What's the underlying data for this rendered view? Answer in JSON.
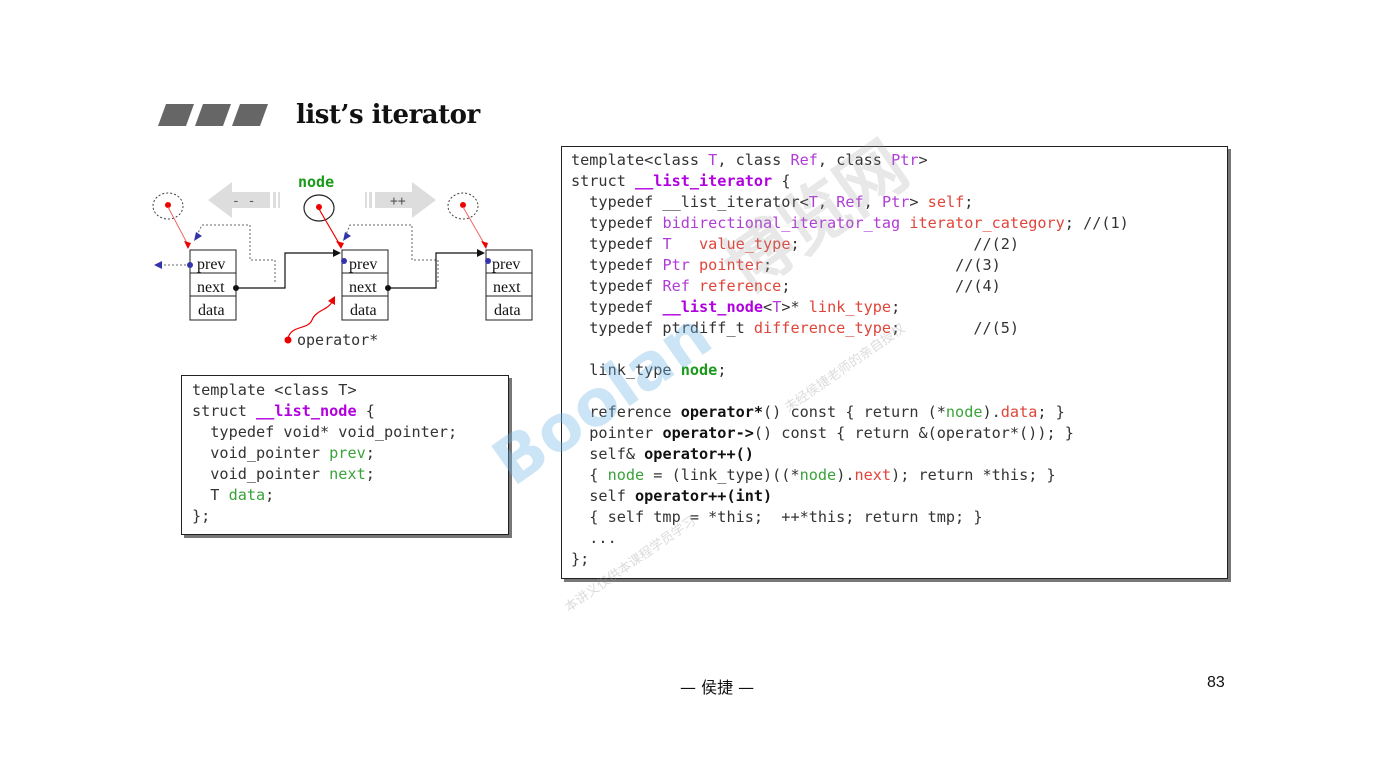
{
  "slide": {
    "title": "list’s iterator",
    "author": "— 侯捷 —",
    "page_number": "83"
  },
  "diagram": {
    "node_label": "node",
    "decrement_label": "- -",
    "increment_label": "++",
    "operator_label": "operator*",
    "cells": {
      "prev": "prev",
      "next": "next",
      "data": "data"
    }
  },
  "node_code": {
    "l1": "template <class T>",
    "l2a": "struct ",
    "l2b": "__list_node",
    "l2c": " {",
    "l3": "  typedef void* void_pointer;",
    "l4a": "  void_pointer ",
    "l4b": "prev",
    "l4c": ";",
    "l5a": "  void_pointer ",
    "l5b": "next",
    "l5c": ";",
    "l6a": "  T ",
    "l6b": "data",
    "l6c": ";",
    "l7": "};"
  },
  "iter_code": {
    "l1a": "template<class ",
    "l1b": "T",
    "l1c": ", class ",
    "l1d": "Ref",
    "l1e": ", class ",
    "l1f": "Ptr",
    "l1g": ">",
    "l2a": "struct ",
    "l2b": "__list_iterator",
    "l2c": " {",
    "l3a": "  typedef __list_iterator<",
    "l3b": "T",
    "l3c": ", ",
    "l3d": "Ref",
    "l3e": ", ",
    "l3f": "Ptr",
    "l3g": "> ",
    "l3h": "self",
    "l3i": ";",
    "l4a": "  typedef ",
    "l4b": "bidirectional_iterator_tag",
    "l4c": " ",
    "l4d": "iterator_category",
    "l4e": "; //(1)",
    "l5a": "  typedef ",
    "l5b": "T",
    "l5c": "   ",
    "l5d": "value_type",
    "l5e": ";                   //(2)",
    "l6a": "  typedef ",
    "l6b": "Ptr",
    "l6c": " ",
    "l6d": "pointer",
    "l6e": ";                    //(3)",
    "l7a": "  typedef ",
    "l7b": "Ref",
    "l7c": " ",
    "l7d": "reference",
    "l7e": ";                  //(4)",
    "l8a": "  typedef ",
    "l8b": "__list_node",
    "l8c": "<",
    "l8d": "T",
    "l8e": ">* ",
    "l8f": "link_type",
    "l8g": ";",
    "l9a": "  typedef ptrdiff_t ",
    "l9b": "difference_type",
    "l9c": ";        //(5)",
    "l10a": "  link_type ",
    "l10b": "node",
    "l10c": ";",
    "l11a": "  reference ",
    "l11b": "operator*",
    "l11c": "() const { return (*",
    "l11d": "node",
    "l11e": ").",
    "l11f": "data",
    "l11g": "; }",
    "l12a": "  pointer ",
    "l12b": "operator->",
    "l12c": "() const { return &(operator*()); }",
    "l13a": "  self& ",
    "l13b": "operator++()",
    "l14a": "  { ",
    "l14b": "node",
    "l14c": " = (link_type)((*",
    "l14d": "node",
    "l14e": ").",
    "l14f": "next",
    "l14g": "); return *this; }",
    "l15a": "  self ",
    "l15b": "operator++(int)",
    "l16": "  { self tmp = *this;  ++*this; return tmp; }",
    "l17": "  ...",
    "l18": "};"
  },
  "watermark": {
    "brand": "Boolan",
    "cn": "博览网",
    "note1": "本讲义仅供本课程学员学习",
    "note2": "未经侯捷老师的亲自授权"
  },
  "colors": {
    "template_param": "#b03cd6",
    "typedef_name": "#e0453a",
    "member": "#3aa33a",
    "struct_name": "#b000e0",
    "node_label": "#1a9a1a",
    "watermark_blue": "#6fb6e8"
  }
}
